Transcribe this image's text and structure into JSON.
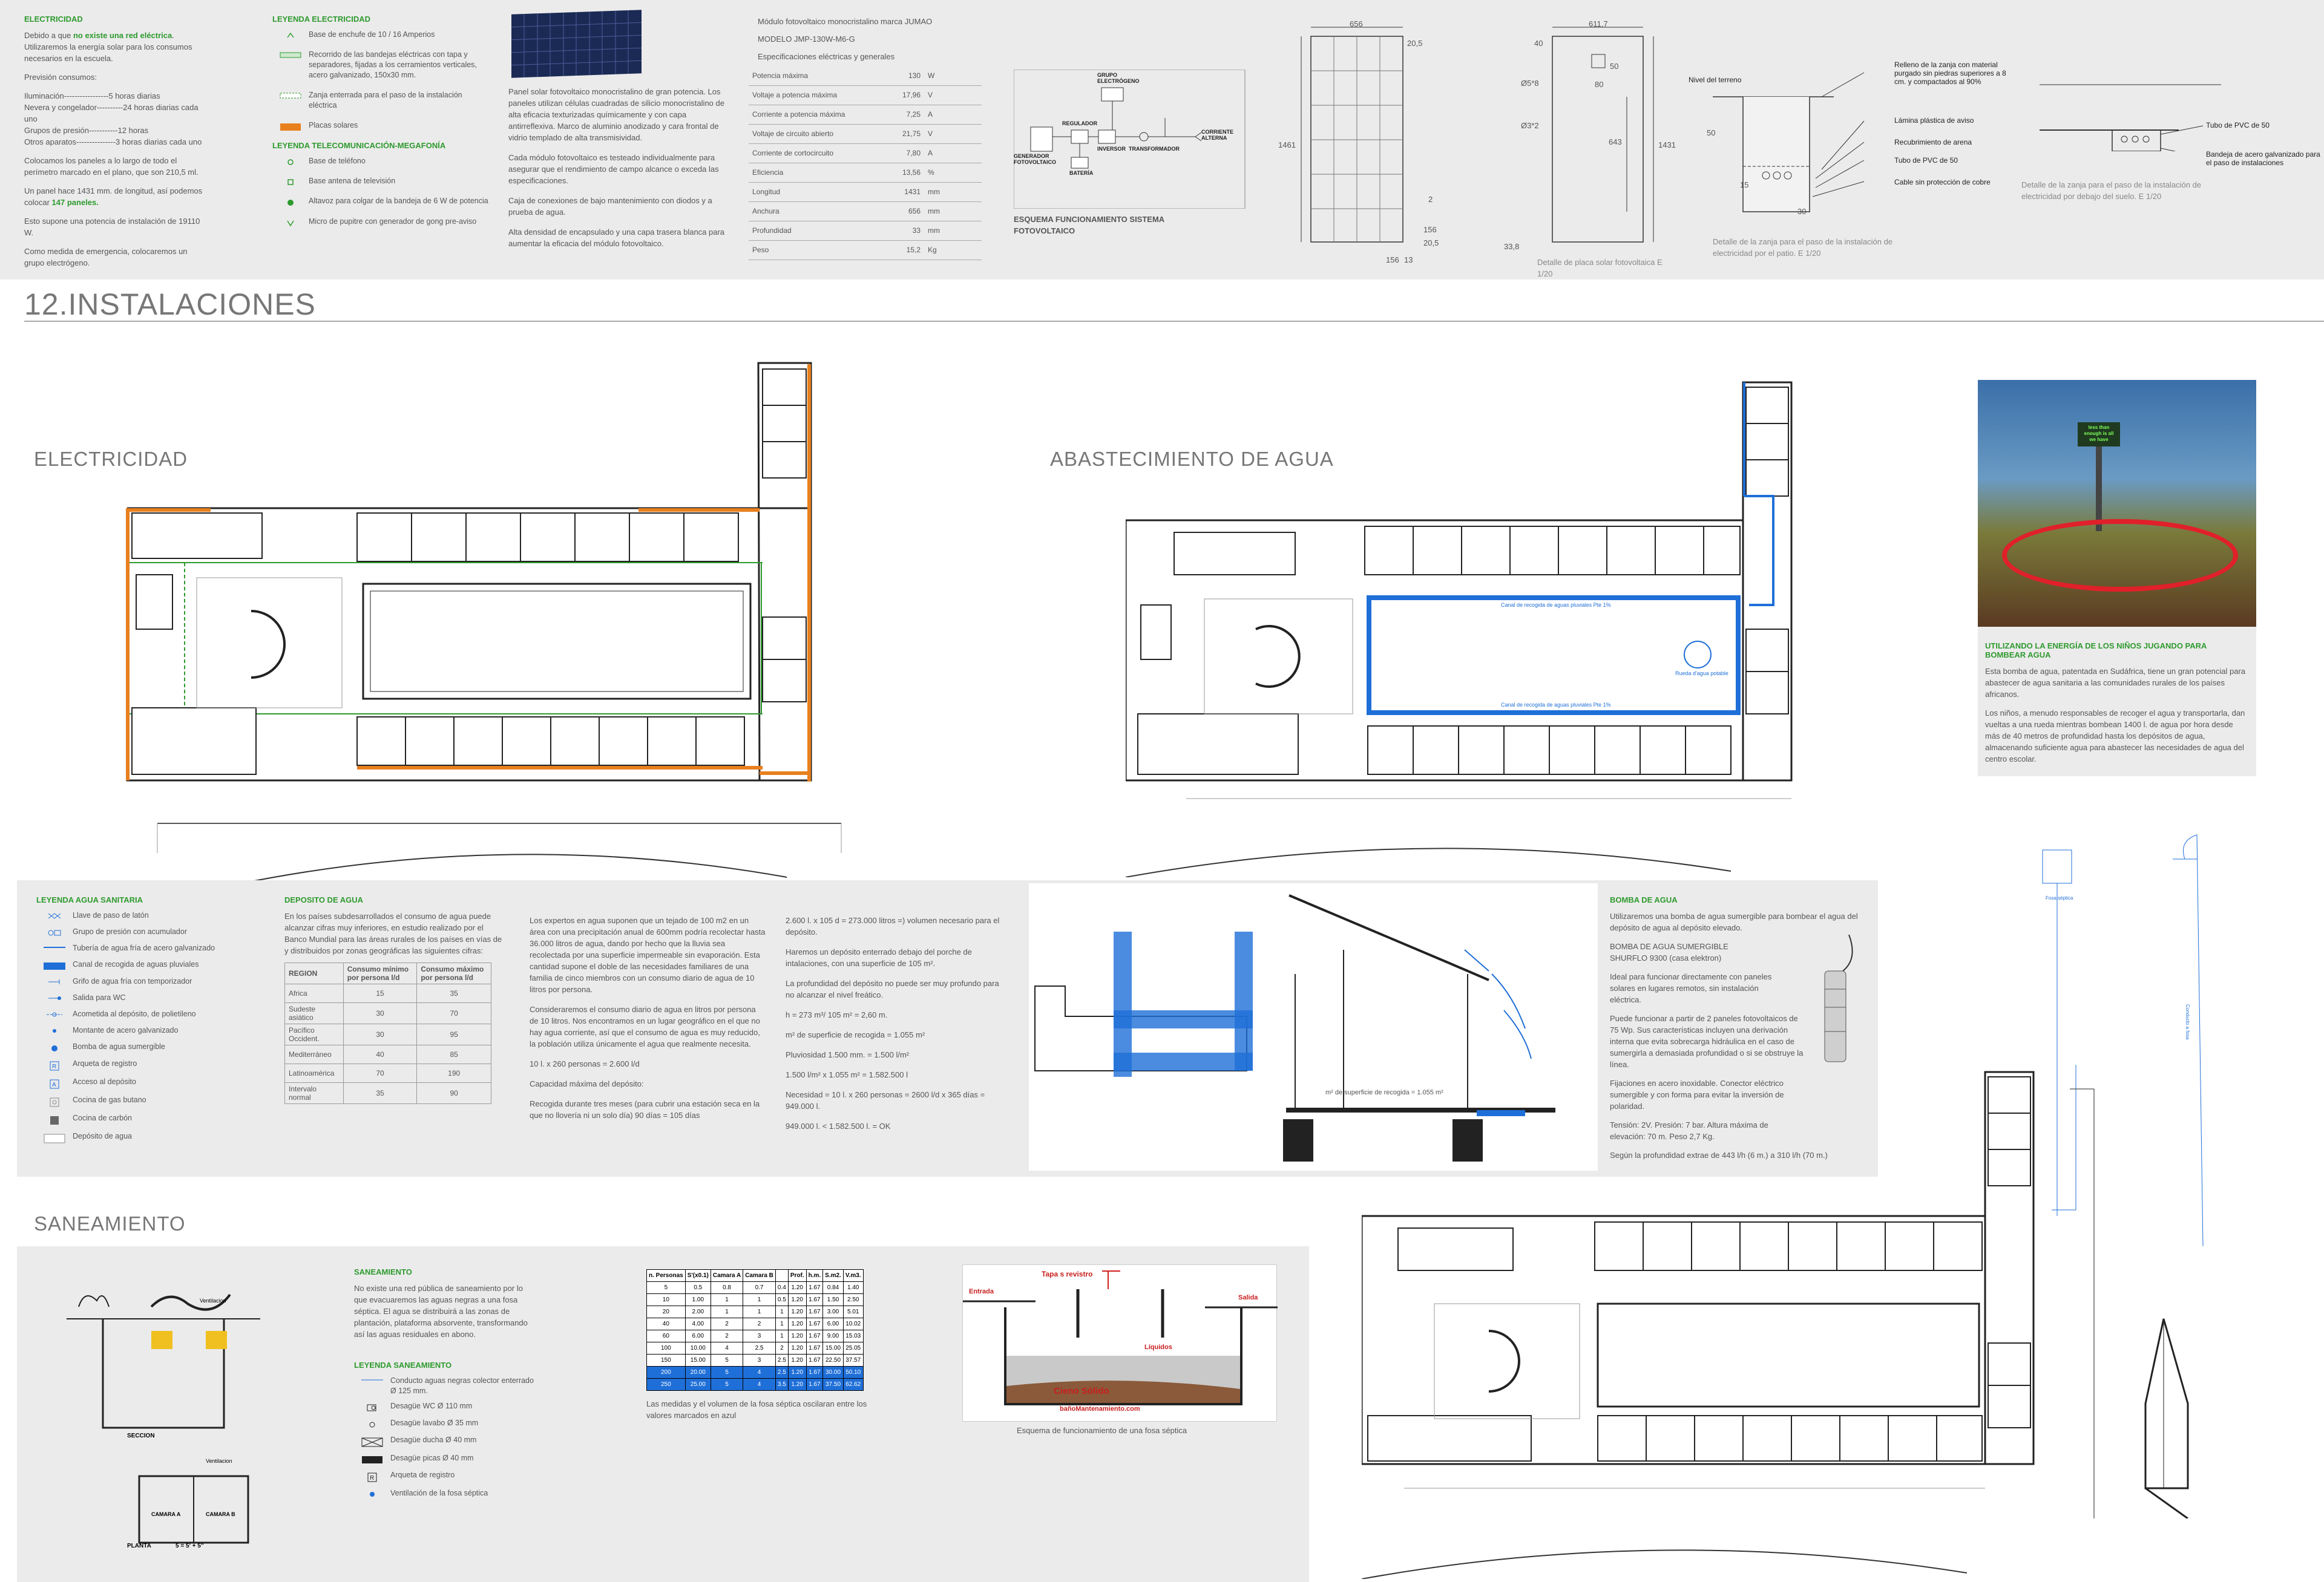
{
  "page_title": "12.INSTALACIONES",
  "electricidad": {
    "heading": "ELECTRICIDAD",
    "intro_pre": "Debido a que ",
    "intro_bold": "no existe una red eléctrica",
    "intro_post": ". Utilizaremos la energía solar para los consumos necesarios en la escuela.",
    "forecast_title": "Previsión consumos:",
    "consumption": [
      "Iluminación-----------------5 horas diarias",
      "Nevera y congelador----------24 horas diarias cada uno",
      "Grupos de presión-----------12 horas",
      "Otros aparatos---------------3 horas diarias cada uno"
    ],
    "panels_pre": "Colocamos los paneles a lo largo de todo el perímetro marcado en el plano, que son 210,5 ml.",
    "panel_count_pre": "Un panel hace 1431 mm. de longitud, así podemos colocar",
    "panel_count": "147 paneles.",
    "power": "Esto supone una potencia de instalación de 19110 W.",
    "emergency": "Como medida de emergencia, colocaremos un grupo electrógeno."
  },
  "leyenda_electricidad": {
    "heading": "LEYENDA ELECTRICIDAD",
    "items": [
      "Base de enchufe de 10 / 16 Amperios",
      "Recorrido de las bandejas eléctricas con tapa y separadores, fijadas a los cerramientos verticales, acero galvanizado, 150x30 mm.",
      "Zanja enterrada para el paso de la instalación eléctrica",
      "Placas solares"
    ]
  },
  "leyenda_tele": {
    "heading": "LEYENDA  TELECOMUNICACIÓN-MEGAFONÍA",
    "items": [
      "Base de teléfono",
      "Base antena de televisión",
      "Altavoz para colgar de la bandeja de 6 W de potencia",
      "Micro de pupitre con generador de gong pre-aviso"
    ]
  },
  "panel_solar": {
    "text": [
      "Panel solar fotovoltaico monocristalino de gran potencia. Los paneles utilizan células cuadradas de silicio monocristalino de alta eficacia texturizadas químicamente y con capa antirreflexiva. Marco de aluminio anodizado y cara frontal de vidrio templado de alta transmisividad.",
      "Cada módulo fotovoltaico es testeado individualmente para asegurar que el rendimiento de campo alcance o exceda las especificaciones.",
      "Caja de conexiones de bajo mantenimiento con diodos y a prueba de agua.",
      "Alta densidad de encapsulado y una capa trasera blanca para aumentar la eficacia del módulo fotovoltaico."
    ]
  },
  "modulo": {
    "title": "Módulo fotovoltaico monocristalino marca JUMAO",
    "model": "MODELO JMP-130W-M6-G",
    "spec_title": "Especificaciones eléctricas y generales",
    "specs": [
      [
        "Potencia máxima",
        "130",
        "W"
      ],
      [
        "Voltaje a potencia máxima",
        "17,96",
        "V"
      ],
      [
        "Corriente a potencia máxima",
        "7,25",
        "A"
      ],
      [
        "Voltaje de circuito abierto",
        "21,75",
        "V"
      ],
      [
        "Corriente de cortocircuito",
        "7,80",
        "A"
      ],
      [
        "Eficiencia",
        "13,56",
        "%"
      ],
      [
        "Longitud",
        "1431",
        "mm"
      ],
      [
        "Anchura",
        "656",
        "mm"
      ],
      [
        "Profundidad",
        "33",
        "mm"
      ],
      [
        "Peso",
        "15,2",
        "Kg"
      ]
    ]
  },
  "esquema": {
    "title": "ESQUEMA FUNCIONAMIENTO SISTEMA FOTOVOLTAICO",
    "labels": [
      "GRUPO ELECTRÓGENO",
      "REGULADOR",
      "INVERSOR",
      "TRANSFORMADOR",
      "CORRIENTE ALTERNA",
      "GENERADOR FOTOVOLTAICO",
      "BATERÍA"
    ]
  },
  "placa_detail": {
    "dims": [
      "656",
      "20,5",
      "1461",
      "2",
      "156",
      "20,5",
      "156",
      "13",
      "611,7",
      "40",
      "50",
      "80",
      "Ø5*8",
      "Ø3*2",
      "643",
      "1431",
      "33,8"
    ],
    "caption": "Detalle de placa solar fotovoltaica E 1/20"
  },
  "zanja": {
    "labels": [
      "Nivel del terreno",
      "Relleno de la zanja con material purgado sin piedras superiores a 8 cm. y compactados al 90%",
      "Lámina plástica de aviso",
      "Recubrimiento de arena",
      "Tubo de PVC de 50",
      "Cable sin protección de cobre"
    ],
    "dims": [
      "50",
      "15",
      "30"
    ],
    "caption": "Detalle de la zanja para el paso de la instalación de electricidad por el patio. E 1/20"
  },
  "bandeja": {
    "labels": [
      "Tubo de PVC de 50",
      "Bandeja de acero galvanizado para el paso de instalaciones"
    ],
    "caption": "Detalle de la zanja para el paso de la instalación de electricidad por debajo del suelo. E 1/20"
  },
  "sections": {
    "electricidad": "ELECTRICIDAD",
    "agua": "ABASTECIMIENTO DE AGUA",
    "saneamiento": "SANEAMIENTO"
  },
  "agua_plan": {
    "canal_top": "Canal de recogida de aguas pluviales  Pte 1%",
    "canal_bottom": "Canal de recogida de aguas pluviales  Pte 1%",
    "rueda": "Rueda d'agua potable"
  },
  "photo": {
    "sign": "less than enough is all we have",
    "title": "UTILIZANDO LA ENERGÍA DE LOS NIÑOS JUGANDO PARA BOMBEAR AGUA",
    "text": [
      "Esta bomba de agua, patentada en Sudáfrica, tiene un gran potencial para abastecer de agua sanitaria a las comunidades rurales de los países africanos.",
      "Los niños, a menudo responsables de recoger el agua y transportarla, dan vueltas a una rueda mientras bombean 1400 l. de agua por hora desde más de 40 metros de profundidad hasta los depósitos de agua, almacenando suficiente agua para abastecer las necesidades de agua del centro escolar."
    ]
  },
  "leyenda_agua": {
    "heading": "LEYENDA AGUA SANITARIA",
    "items": [
      "Llave de paso de latón",
      "Grupo de presión con acumulador",
      "Tubería de agua fría de acero galvanizado",
      "Canal de recogida de aguas pluviales",
      "Grifo de agua fría con temporizador",
      "Salida para WC",
      "Acometida al depósito, de polietileno",
      "Montante de acero galvanizado",
      "Bomba de agua sumergible",
      "Arqueta de registro",
      "Acceso al depósito",
      "Cocina de gas butano",
      "Cocina de carbón",
      "Depósito de agua"
    ]
  },
  "deposito": {
    "heading": "DEPOSITO DE AGUA",
    "intro": "En los países subdesarrollados el consumo de agua puede alcanzar cifras muy inferiores, en estudio realizado por el Banco Mundial para las áreas rurales de los países en vías de  y distribuidos por zonas geográficas  las siguientes cifras:",
    "headers": [
      "REGION",
      "Consumo mínimo por persona l/d",
      "Consumo máximo por persona l/d"
    ],
    "rows": [
      [
        "Africa",
        "15",
        "35"
      ],
      [
        "Sudeste asiático",
        "30",
        "70"
      ],
      [
        "Pacífico Occident.",
        "30",
        "95"
      ],
      [
        "Mediterráneo",
        "40",
        "85"
      ],
      [
        "Latinoamérica",
        "70",
        "190"
      ],
      [
        "Intervalo normal",
        "35",
        "90"
      ]
    ],
    "col1": [
      "Los expertos en agua suponen que un tejado de 100 m2 en un área con una precipitación anual de 600mm podría recolectar hasta 36.000 litros de agua, dando por hecho que la lluvia sea recolectada por una superficie impermeable sin evaporación. Esta cantidad supone el doble de las necesidades familiares de una familia de cinco miembros con un consumo diario de agua de 10 litros por persona.",
      "Consideraremos el consumo diario de agua en litros por persona de 10 litros. Nos encontramos en un lugar geográfico en el que no hay agua corriente, así que el consumo de agua es muy reducido, la población utiliza únicamente el agua que realmente necesita.",
      "10 l. x 260 personas = 2.600 l/d",
      "Capacidad máxima del depósito:",
      "Recogida durante tres meses (para cubrir una estación seca en la que no llovería ni un solo día) 90 días = 105 días"
    ],
    "col2": [
      "2.600 l. x 105 d = 273.000 litros =) volumen necesario para el depósito.",
      "Haremos un depósito enterrado debajo del porche de intalaciones, con una superficie de 105 m².",
      "La profundidad del depósito no puede ser muy profundo para no alcanzar el nivel freático.",
      "h = 273 m³/ 105 m² = 2,60 m.",
      "m² de superficie de recogida = 1.055 m²",
      "Pluviosidad 1.500 mm. = 1.500 l/m²",
      "1.500 l/m² x 1.055 m² = 1.582.500 l",
      "Necesidad = 10 l. x 260 personas = 2600 l/d x 365 días = 949.000 l.",
      "949.000 l. < 1.582.500 l. = OK"
    ],
    "recogida": "m² de superficie de recogida = 1.055 m²"
  },
  "bomba": {
    "heading": "BOMBA DE AGUA",
    "text": [
      "Utilizaremos una bomba de agua sumergible para bombear el agua del depósito de agua al depósito elevado.",
      "BOMBA DE AGUA SUMERGIBLE SHURFLO 9300 (casa elektron)",
      "Ideal para funcionar directamente con paneles solares en lugares remotos, sin instalación eléctrica.",
      "Puede funcionar a partir de 2 paneles fotovoltaicos de 75 Wp. Sus características incluyen una derivación interna que evita sobrecarga hidráulica en el caso de sumergirla a demasiada profundidad o si se obstruye la línea.",
      "Fijaciones en acero inoxidable. Conector eléctrico sumergible y con forma para evitar la inversión de polaridad.",
      "Tensión: 2V. Presión: 7 bar. Altura máxima de elevación: 70 m. Peso 2,7 Kg.",
      "Según la profundidad extrae de 443 l/h (6 m.) a 310 l/h (70 m.)"
    ]
  },
  "saneamiento": {
    "heading": "SANEAMIENTO",
    "text": "No existe una red pública de saneamiento por lo que evacuaremos las aguas negras a una fosa séptica. El agua se distribuirá a las zonas de plantación, plataforma absorvente, transformando así las aguas residuales en abono.",
    "legend_heading": "LEYENDA SANEAMIENTO",
    "legend": [
      "Conducto aguas negras colector enterrado Ø 125 mm.",
      "Desagüe WC Ø 110 mm",
      "Desagüe lavabo Ø 35 mm",
      "Desagüe ducha Ø 40 mm",
      "Desagüe picas Ø 40 mm",
      "Arqueta de registro",
      "Ventilación de la fosa séptica"
    ],
    "section_labels": [
      "Ventilacion",
      "SECCION",
      "Ventilacion",
      "CAMARA A",
      "CAMARA B",
      "PLANTA",
      "5 = 5' + 5''"
    ],
    "table_headers": [
      "n. Personas",
      "S'(x0.1)",
      "Camara A",
      "Camara B",
      "Prof.",
      "h.m.",
      "S.m2.",
      "V.m3."
    ],
    "table_rows": [
      [
        "5",
        "0.5",
        "0.8",
        "0.7",
        "0.4",
        "1.20",
        "1.67",
        "0.84",
        "1.40"
      ],
      [
        "10",
        "1.00",
        "1",
        "1",
        "0.5",
        "1.20",
        "1.67",
        "1.50",
        "2.50"
      ],
      [
        "20",
        "2.00",
        "1",
        "1",
        "1",
        "1.20",
        "1.67",
        "3.00",
        "5.01"
      ],
      [
        "40",
        "4.00",
        "2",
        "2",
        "1",
        "1.20",
        "1.67",
        "6.00",
        "10.02"
      ],
      [
        "60",
        "6.00",
        "2",
        "3",
        "1",
        "1.20",
        "1.67",
        "9.00",
        "15.03"
      ],
      [
        "100",
        "10.00",
        "4",
        "2.5",
        "2",
        "1.20",
        "1.67",
        "15.00",
        "25.05"
      ],
      [
        "150",
        "15.00",
        "5",
        "3",
        "2.5",
        "1.20",
        "1.67",
        "22.50",
        "37.57"
      ],
      [
        "200",
        "20.00",
        "5",
        "4",
        "2.5",
        "1.20",
        "1.67",
        "30.00",
        "50.10"
      ],
      [
        "250",
        "25.00",
        "5",
        "4",
        "3.5",
        "1.20",
        "1.67",
        "37.50",
        "62.62"
      ]
    ],
    "table_note": "Las medidas y el volumen de la fosa séptica oscilaran entre los valores marcados en azul",
    "fosa_labels": [
      "Tapa s revistro",
      "Entrada",
      "Salida",
      "Líquidos",
      "Cieno Sólido",
      "bañoMantenamiento.com"
    ],
    "fosa_caption": "Esquema de funcionamiento de una fosa séptica"
  },
  "side_plan": {
    "label1": "Fosa séptica",
    "label2": "Conducto a fosa"
  },
  "colors": {
    "green": "#2e9a2e",
    "orange": "#e8801e",
    "blue": "#1f6fd8",
    "panel": "#ebebeb"
  }
}
